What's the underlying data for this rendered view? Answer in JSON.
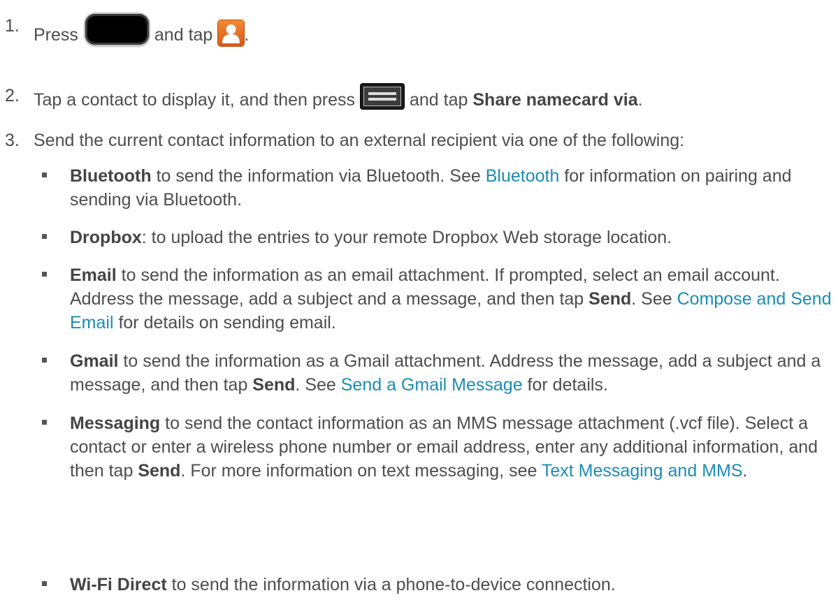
{
  "steps": [
    {
      "number": "1.",
      "pre": "Press",
      "mid": "and tap",
      "post": "."
    },
    {
      "number": "2.",
      "pre": "Tap a contact to display it, and then press",
      "mid": "and tap",
      "bold": "Share namecard via",
      "post": "."
    },
    {
      "number": "3.",
      "text": "Send the current contact information to an external recipient via one of the following:"
    }
  ],
  "bullets": [
    {
      "bold": "Bluetooth",
      "text1": " to send the information via Bluetooth. See ",
      "link": "Bluetooth",
      "text2": " for information on pairing and sending via Bluetooth."
    },
    {
      "bold": "Dropbox",
      "text1": ": to upload the entries to your remote Dropbox Web storage location."
    },
    {
      "bold": "Email",
      "text1": " to send the information as an email attachment. If prompted, select an email account. Address the message, add a subject and a message, and then tap ",
      "bold2": "Send",
      "text2": ". See ",
      "link": "Compose and Send Email",
      "text3": " for details on sending email."
    },
    {
      "bold": "Gmail",
      "text1": " to send the information as a Gmail attachment. Address the message, add a subject and a message, and then tap ",
      "bold2": "Send",
      "text2": ". See ",
      "link": "Send a Gmail Message",
      "text3": " for details."
    },
    {
      "bold": "Messaging",
      "text1": " to send the contact information as an MMS message attachment (.vcf file). Select a contact or enter a wireless phone number or email address, enter any additional information, and then tap ",
      "bold2": "Send",
      "text2": ". For more information on text messaging, see ",
      "link": "Text Messaging and MMS",
      "text3": "."
    },
    {
      "bold": "Wi-Fi Direct",
      "text1": " to send the information via a phone-to-device connection."
    }
  ],
  "icons": {
    "home_key": "home-key-icon",
    "contacts_app": "contacts-icon",
    "menu_key": "menu-key-icon"
  },
  "colors": {
    "text": "#4d4d4d",
    "link": "#1b8db3",
    "contacts_icon": "#e8702a"
  }
}
